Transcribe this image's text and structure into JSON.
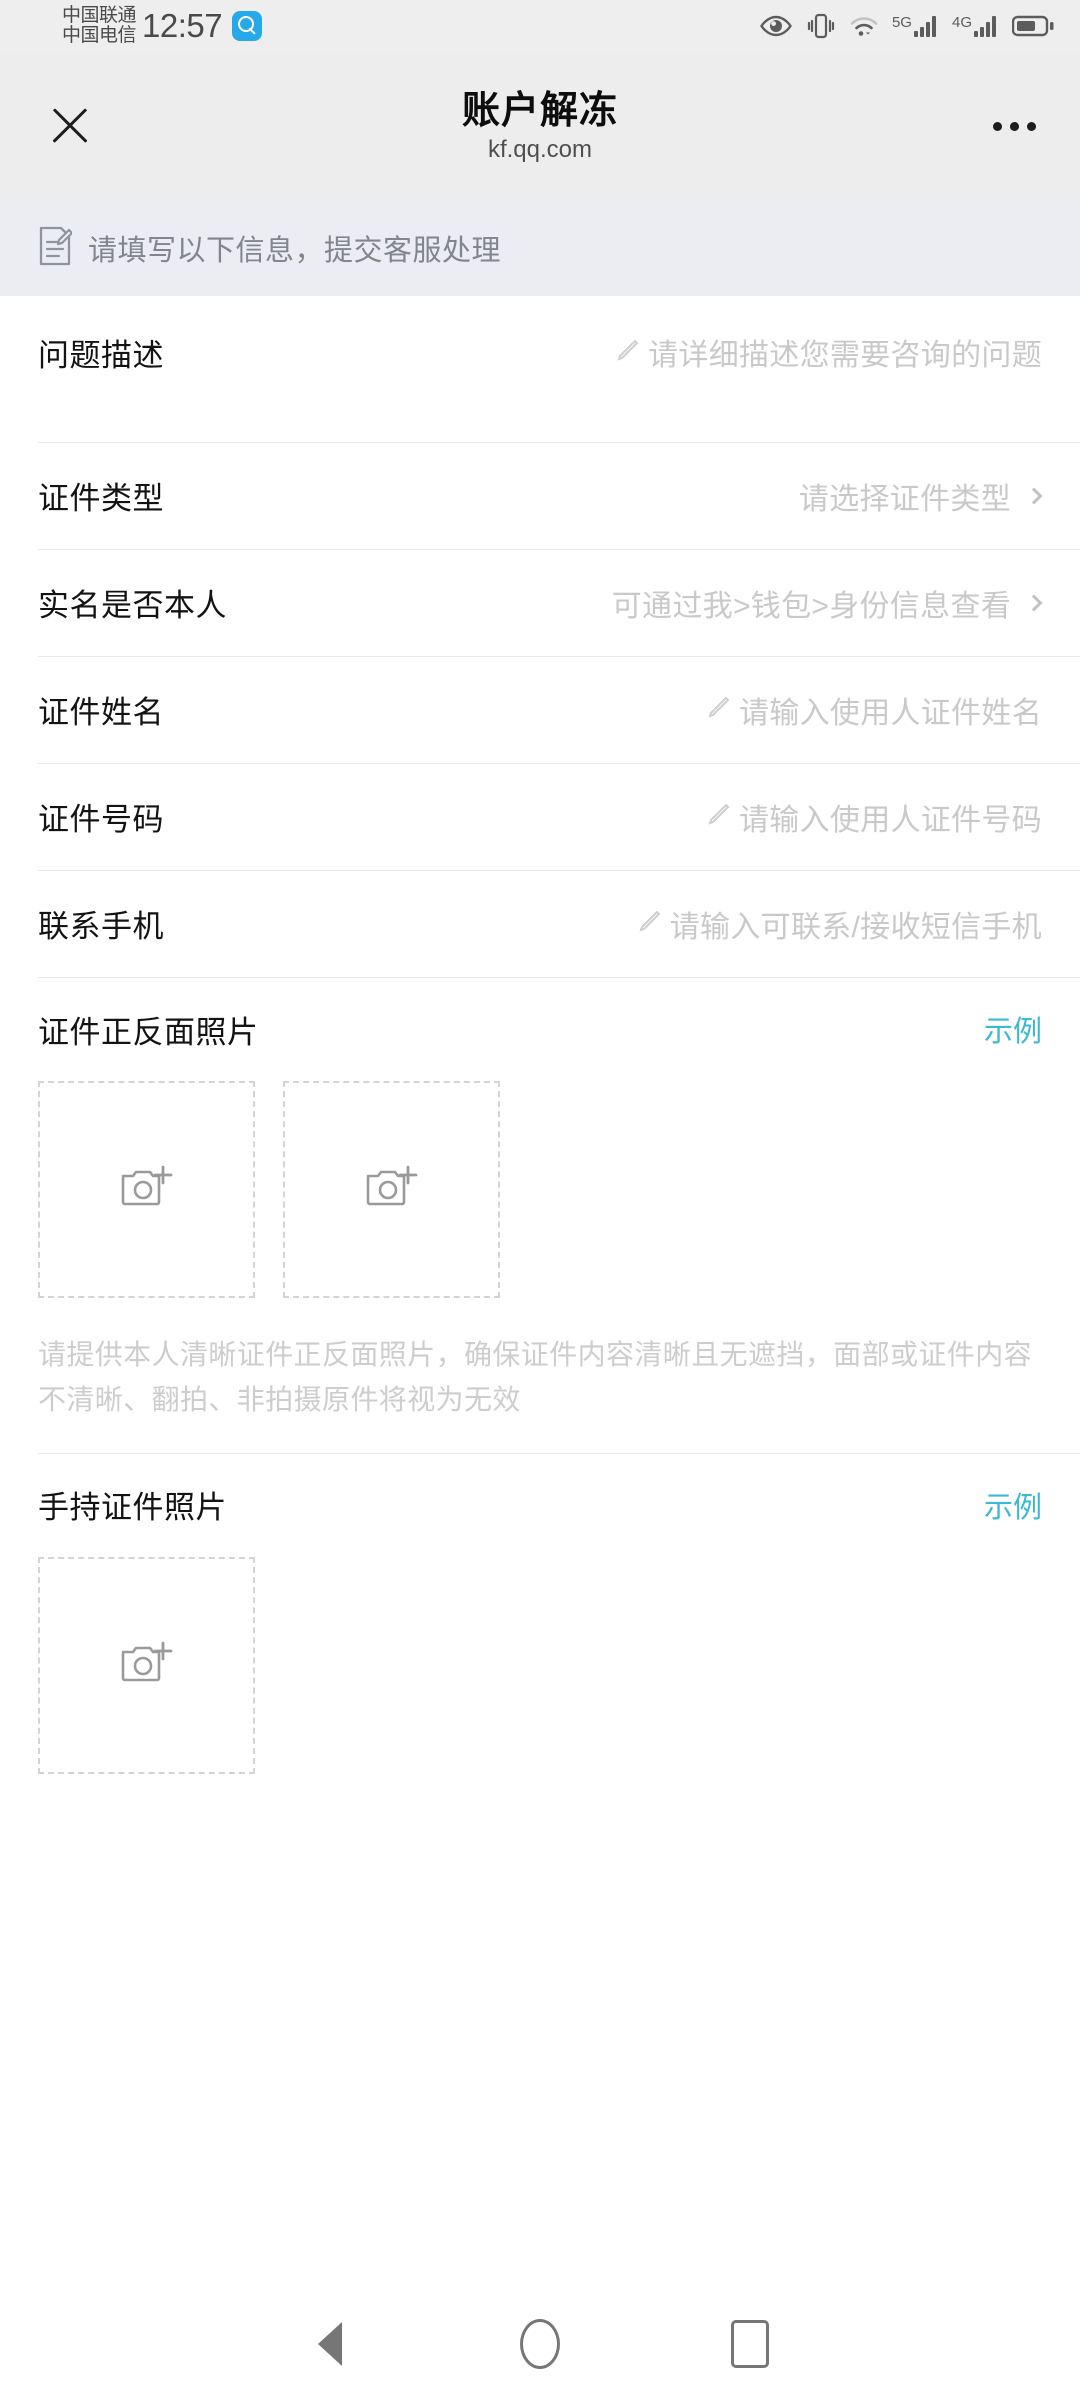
{
  "status_bar": {
    "carrier_primary": "中国联通",
    "carrier_secondary": "中国电信",
    "time": "12:57",
    "search_icon": "search-icon",
    "icons": [
      "eye-comfort-icon",
      "vibrate-icon",
      "wifi-icon",
      "signal-5g-icon",
      "signal-4g-icon",
      "battery-icon"
    ],
    "signal_5g_label": "5G",
    "signal_4g_label": "4G"
  },
  "header": {
    "close_icon": "close-icon",
    "title": "账户解冻",
    "subtitle": "kf.qq.com",
    "more_icon": "more-options-icon"
  },
  "notice": {
    "icon": "note-edit-icon",
    "text": "请填写以下信息，提交客服处理"
  },
  "form": {
    "rows": [
      {
        "label": "问题描述",
        "placeholder": "请详细描述您需要咨询的问题",
        "type": "textarea",
        "icon": "pencil-icon"
      },
      {
        "label": "证件类型",
        "placeholder": "请选择证件类型",
        "type": "select",
        "icon": "chevron-right-icon"
      },
      {
        "label": "实名是否本人",
        "placeholder": "可通过我>钱包>身份信息查看",
        "type": "select",
        "icon": "chevron-right-icon"
      },
      {
        "label": "证件姓名",
        "placeholder": "请输入使用人证件姓名",
        "type": "text",
        "icon": "pencil-icon"
      },
      {
        "label": "证件号码",
        "placeholder": "请输入使用人证件号码",
        "type": "text",
        "icon": "pencil-icon"
      },
      {
        "label": "联系手机",
        "placeholder": "请输入可联系/接收短信手机",
        "type": "text",
        "icon": "pencil-icon"
      }
    ]
  },
  "upload_sections": [
    {
      "title": "证件正反面照片",
      "example_link": "示例",
      "boxes": [
        "camera-add-icon",
        "camera-add-icon"
      ],
      "hint": "请提供本人清晰证件正反面照片，确保证件内容清晰且无遮挡，面部或证件内容不清晰、翻拍、非拍摄原件将视为无效"
    },
    {
      "title": "手持证件照片",
      "example_link": "示例",
      "boxes": [
        "camera-add-icon"
      ],
      "hint": ""
    }
  ],
  "nav_bar": {
    "back": "back-icon",
    "home": "home-icon",
    "recents": "recents-icon"
  },
  "colors": {
    "accent_link": "#3ab8d4",
    "search_badge": "#27a9e9",
    "status_bar_bg": "#eeeeee",
    "header_bg": "#ededed",
    "notice_bg": "#ebedf2",
    "label_text": "#131313",
    "placeholder_text": "#c9c9c9",
    "hint_text": "#cdcdcd"
  }
}
